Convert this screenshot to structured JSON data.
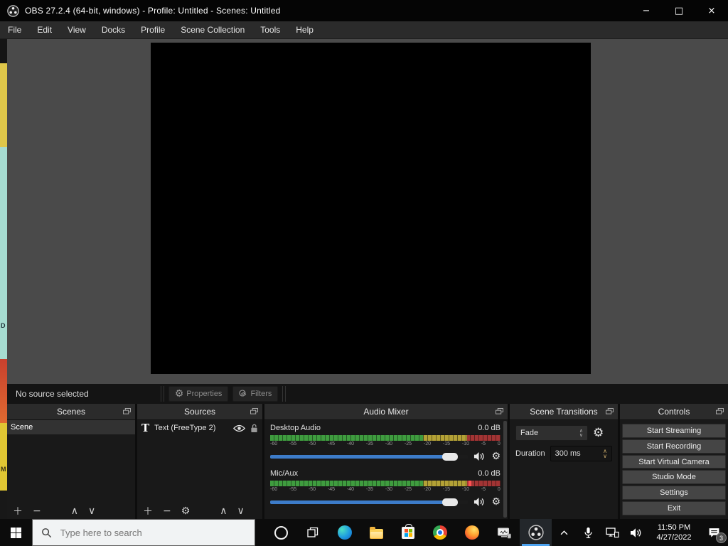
{
  "window": {
    "title": "OBS 27.2.4 (64-bit, windows) - Profile: Untitled - Scenes: Untitled",
    "minimize_glyph": "−",
    "maximize_glyph": "□",
    "close_glyph": "×"
  },
  "menubar": {
    "items": [
      "File",
      "Edit",
      "View",
      "Docks",
      "Profile",
      "Scene Collection",
      "Tools",
      "Help"
    ]
  },
  "background_window": {
    "fragments": [
      "D",
      "M"
    ]
  },
  "source_toolbar": {
    "status": "No source selected",
    "properties_label": "Properties",
    "filters_label": "Filters"
  },
  "scenes": {
    "title": "Scenes",
    "items": [
      "Scene"
    ]
  },
  "sources": {
    "title": "Sources",
    "items": [
      {
        "icon": "T",
        "label": "Text (FreeType 2)"
      }
    ]
  },
  "audio_mixer": {
    "title": "Audio Mixer",
    "channels": [
      {
        "name": "Desktop Audio",
        "level_db": "0.0 dB"
      },
      {
        "name": "Mic/Aux",
        "level_db": "0.0 dB"
      }
    ],
    "scale": [
      "-60",
      "-55",
      "-50",
      "-45",
      "-40",
      "-35",
      "-30",
      "-25",
      "-20",
      "-15",
      "-10",
      "-5",
      "0"
    ]
  },
  "scene_transitions": {
    "title": "Scene Transitions",
    "transition": "Fade",
    "duration_label": "Duration",
    "duration_value": "300 ms"
  },
  "controls_panel": {
    "title": "Controls",
    "buttons": [
      "Start Streaming",
      "Start Recording",
      "Start Virtual Camera",
      "Studio Mode",
      "Settings",
      "Exit"
    ]
  },
  "taskbar": {
    "search_placeholder": "Type here to search",
    "clock_time": "11:50 PM",
    "clock_date": "4/27/2022",
    "notification_count": "3"
  },
  "icons": {
    "plus": "＋",
    "minus": "−",
    "up": "∧",
    "down": "∨",
    "gear": "⚙"
  },
  "colors": {
    "accent_blue": "#3d7cc9",
    "meter_green": "#3f9c3f",
    "meter_yellow": "#b3a136",
    "meter_red": "#a23434",
    "taskbar_active_underline": "#4da3f0"
  }
}
